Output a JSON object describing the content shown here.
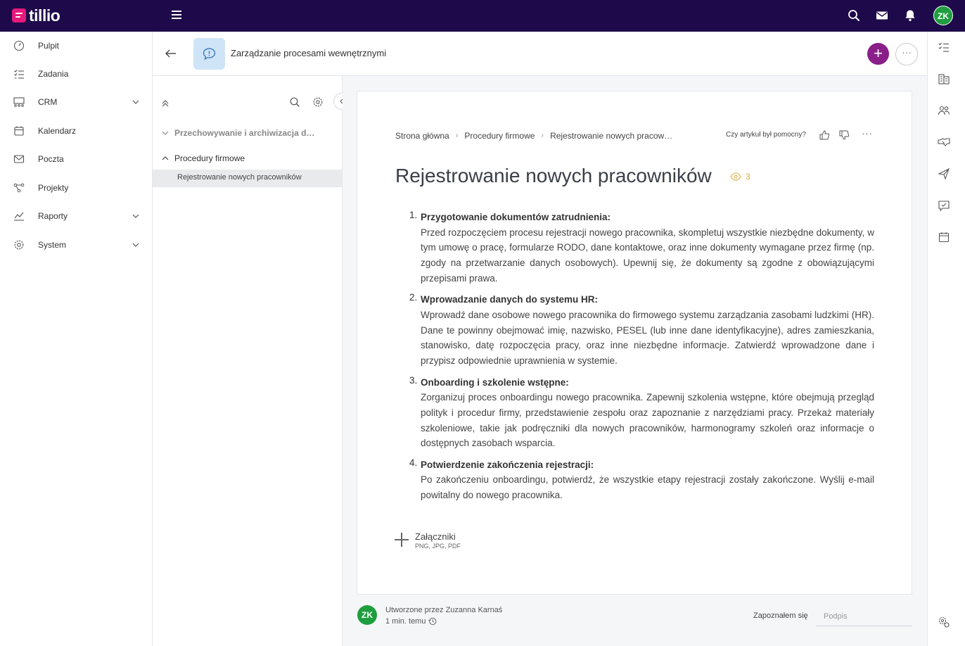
{
  "app": {
    "name": "tillio",
    "user_initials": "ZK"
  },
  "sidebar": {
    "items": [
      {
        "label": "Pulpit",
        "icon": "dashboard-icon",
        "has_chevron": false
      },
      {
        "label": "Zadania",
        "icon": "tasks-icon",
        "has_chevron": false
      },
      {
        "label": "CRM",
        "icon": "crm-icon",
        "has_chevron": true
      },
      {
        "label": "Kalendarz",
        "icon": "calendar-icon",
        "has_chevron": false
      },
      {
        "label": "Poczta",
        "icon": "mail-icon",
        "has_chevron": false
      },
      {
        "label": "Projekty",
        "icon": "projects-icon",
        "has_chevron": false
      },
      {
        "label": "Raporty",
        "icon": "reports-icon",
        "has_chevron": true
      },
      {
        "label": "System",
        "icon": "gear-icon",
        "has_chevron": true
      }
    ]
  },
  "header": {
    "title": "Zarządzanie procesami wewnętrznymi"
  },
  "tree": {
    "nodes": [
      {
        "label": "Przechowywanie i archiwizacja dokumentów",
        "expanded": false
      },
      {
        "label": "Procedury firmowe",
        "expanded": true
      }
    ],
    "selected_child": "Rejestrowanie nowych pracowników"
  },
  "article": {
    "breadcrumb": [
      "Strona główna",
      "Procedury firmowe",
      "Rejestrowanie nowych pracowników"
    ],
    "helpful_question": "Czy artykuł był pomocny?",
    "title": "Rejestrowanie nowych pracowników",
    "views": "3",
    "steps": [
      {
        "num": "1.",
        "title": "Przygotowanie dokumentów zatrudnienia:",
        "text": "Przed rozpoczęciem procesu rejestracji nowego pracownika, skompletuj wszystkie niezbędne dokumenty, w tym umowę o pracę, formularze RODO, dane kontaktowe, oraz inne dokumenty wymagane przez firmę (np. zgody na przetwarzanie danych osobowych). Upewnij się, że dokumenty są zgodne z obowiązującymi przepisami prawa."
      },
      {
        "num": "2.",
        "title": "Wprowadzanie danych do systemu HR:",
        "text": "Wprowadź dane osobowe nowego pracownika do firmowego systemu zarządzania zasobami ludzkimi (HR). Dane te powinny obejmować imię, nazwisko, PESEL (lub inne dane identyfikacyjne), adres zamieszkania, stanowisko, datę rozpoczęcia pracy, oraz inne niezbędne informacje. Zatwierdź wprowadzone dane i przypisz odpowiednie uprawnienia w systemie."
      },
      {
        "num": "3.",
        "title": "Onboarding i szkolenie wstępne:",
        "text": "Zorganizuj proces onboardingu nowego pracownika. Zapewnij szkolenia wstępne, które obejmują przegląd polityk i procedur firmy, przedstawienie zespołu oraz zapoznanie z narzędziami pracy. Przekaż materiały szkoleniowe, takie jak podręczniki dla nowych pracowników, harmonogramy szkoleń oraz informacje o dostępnych zasobach wsparcia."
      },
      {
        "num": "4.",
        "title": "Potwierdzenie zakończenia rejestracji:",
        "text": "Po zakończeniu onboardingu, potwierdź, że wszystkie etapy rejestracji zostały zakończone. Wyślij e-mail powitalny do nowego pracownika."
      }
    ],
    "attachments": {
      "label": "Załączniki",
      "formats": "PNG, JPG, PDF"
    }
  },
  "footer": {
    "created_by": "Utworzone przez Zuzanna Karnaś",
    "time": "1 min. temu",
    "ack_label": "Zapoznałem się",
    "signature_placeholder": "Podpis"
  },
  "colors": {
    "topbar": "#1e0a4a",
    "brand": "#e6197c",
    "accent": "#8a1f8a",
    "avatar": "#1f9e3f",
    "views": "#d8a93e"
  }
}
